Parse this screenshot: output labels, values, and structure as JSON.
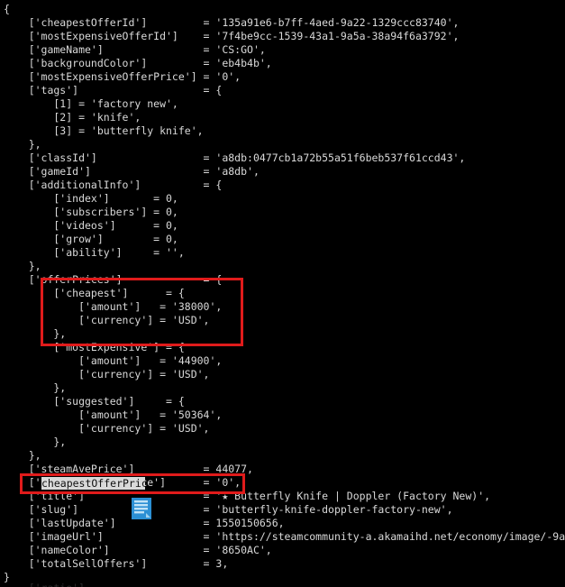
{
  "terminal": {
    "background_color": "#000000",
    "text_color": "#d9d9d9",
    "font_size_px": 11.5,
    "line_height_px": 15
  },
  "dump": {
    "language": "php-var-dump-style",
    "text": "{\n    ['cheapestOfferId']         = '135a91e6-b7ff-4aed-9a22-1329ccc83740',\n    ['mostExpensiveOfferId']    = '7f4be9cc-1539-43a1-9a5a-38a94f6a3792',\n    ['gameName']                = 'CS:GO',\n    ['backgroundColor']         = 'eb4b4b',\n    ['mostExpensiveOfferPrice'] = '0',\n    ['tags']                    = {\n        [1] = 'factory new',\n        [2] = 'knife',\n        [3] = 'butterfly knife',\n    },\n    ['classId']                 = 'a8db:0477cb1a72b55a51f6beb537f61ccd43',\n    ['gameId']                  = 'a8db',\n    ['additionalInfo']          = {\n        ['index']       = 0,\n        ['subscribers'] = 0,\n        ['videos']      = 0,\n        ['grow']        = 0,\n        ['ability']     = '',\n    },\n    ['offerPrices']             = {\n        ['cheapest']      = {\n            ['amount']   = '38000',\n            ['currency'] = 'USD',\n        },\n        ['mostExpensive'] = {\n            ['amount']   = '44900',\n            ['currency'] = 'USD',\n        },\n        ['suggested']     = {\n            ['amount']   = '50364',\n            ['currency'] = 'USD',\n        },\n    },\n    ['steamAvePrice']           = 44077,\n    ['cheapestOfferPrice']      = '0',\n    ['title']                   = '★ Butterfly Knife | Doppler (Factory New)',\n    ['slug']                    = 'butterfly-knife-doppler-factory-new',\n    ['lastUpdate']              = 1550150656,\n    ['imageUrl']                = 'https://steamcommunity-a.akamaihd.net/economy/image/-9a\n    ['nameColor']               = '8650AC',\n    ['totalSellOffers']         = 3,\n}"
  },
  "keys": {
    "cheapestOfferId": "'135a91e6-b7ff-4aed-9a22-1329ccc83740'",
    "mostExpensiveOfferId": "'7f4be9cc-1539-43a1-9a5a-38a94f6a3792'",
    "gameName": "'CS:GO'",
    "backgroundColor": "'eb4b4b'",
    "mostExpensiveOfferPrice": "'0'",
    "tags": [
      "'factory new'",
      "'knife'",
      "'butterfly knife'"
    ],
    "classId": "'a8db:0477cb1a72b55a51f6beb537f61ccd43'",
    "gameId": "'a8db'",
    "additionalInfo": {
      "index": "0",
      "subscribers": "0",
      "videos": "0",
      "grow": "0",
      "ability": "''"
    },
    "offerPrices": {
      "cheapest": {
        "amount": "'38000'",
        "currency": "'USD'"
      },
      "mostExpensive": {
        "amount": "'44900'",
        "currency": "'USD'"
      },
      "suggested": {
        "amount": "'50364'",
        "currency": "'USD'"
      }
    },
    "steamAvePrice": "44077",
    "cheapestOfferPrice": "'0'",
    "title": "'★ Butterfly Knife | Doppler (Factory New)'",
    "slug": "'butterfly-knife-doppler-factory-new'",
    "lastUpdate": "1550150656",
    "imageUrl": "'https://steamcommunity-a.akamaihd.net/economy/image/-9a",
    "nameColor": "'8650AC'",
    "totalSellOffers": "3"
  },
  "annotations": {
    "color": "#e01b1b",
    "box_cheapest_block_label": "cheapest offer price block",
    "box_cheapest_offer_price_label": "cheapestOfferPrice key"
  },
  "selection": {
    "text": "cheapestOfferPrice",
    "background_color": "#d9d9d9",
    "text_color": "#101010"
  },
  "drag_icon": {
    "name": "text-document-icon",
    "color": "#2b8fd4"
  },
  "bottom_cutoff": {
    "text": "    ['ratio']      ..."
  }
}
